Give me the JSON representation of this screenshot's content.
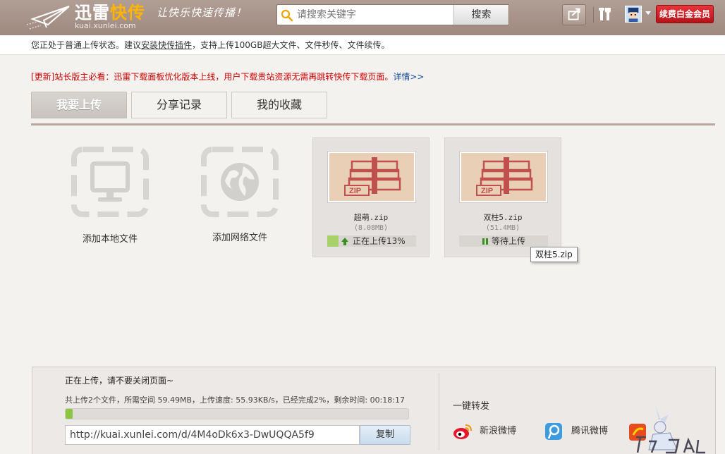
{
  "header": {
    "logo_main": "迅雷",
    "logo_accent": "快传",
    "logo_domain": "kuai.xunlei.com",
    "slogan": "让快乐快速传播！",
    "search_placeholder": "请搜索关键字",
    "search_button": "搜索",
    "vip_button": "续费白金会员",
    "colors": {
      "header_bg": "#a8938a",
      "logo_accent": "#ffb400",
      "vip_red": "#c81e25"
    }
  },
  "notice": {
    "prefix": "您正处于普通上传状态。建议",
    "link": "安装快传插件",
    "suffix": "，支持上传100GB超大文件、文件秒传、文件续传。"
  },
  "announcement": {
    "text": "[更新]站长版主必看：迅雷下载面板优化版本上线，用户下载贵站资源无需再跳转快传下载页面。",
    "more": "详情>>"
  },
  "tabs": [
    {
      "label": "我要上传",
      "active": true
    },
    {
      "label": "分享记录",
      "active": false
    },
    {
      "label": "我的收藏",
      "active": false
    }
  ],
  "add_tiles": [
    {
      "label": "添加本地文件",
      "icon": "monitor-icon"
    },
    {
      "label": "添加网络文件",
      "icon": "globe-icon"
    }
  ],
  "files": [
    {
      "name": "超萌.zip",
      "size": "(8.08MB)",
      "status": "正在上传13%",
      "progress": 13,
      "state": "uploading"
    },
    {
      "name": "双柱5.zip",
      "size": "(51.4MB)",
      "status": "等待上传",
      "progress": 0,
      "state": "waiting"
    }
  ],
  "tooltip": "双柱5.zip",
  "bottom": {
    "title": "正在上传，请不要关闭页面~",
    "stats": "共上传2个文件，所需空间 59.49MB，上传速度: 55.93KB/s，已经完成2%，剩余时间: 00:18:17",
    "overall_progress": 2,
    "url": "http://kuai.xunlei.com/d/4M4oDk6x3-DwUQQA5f9",
    "copy_button": "复制",
    "share_title": "一键转发",
    "share_sina": "新浪微博",
    "share_tencent": "腾讯微博"
  }
}
